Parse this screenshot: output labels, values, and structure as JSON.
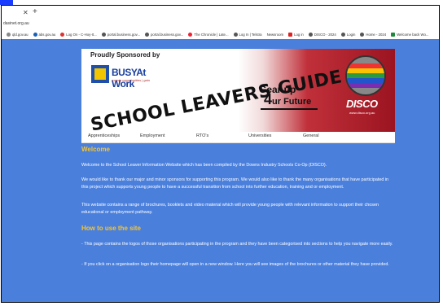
{
  "browser": {
    "url": "dasinet.org.au",
    "bookmarks": [
      "qld.gov.au",
      "abs.gov.au",
      "Log On - C-Hoy-It...",
      "portal.business.gov...",
      "portal.business.gov...",
      "The Chronicle | Late...",
      "Log In | Telstra",
      "Newsroom",
      "Log in",
      "DISCO - 2024",
      "Login",
      "Home - 2024",
      "Welcome back Wo..."
    ]
  },
  "banner": {
    "sponsor_label": "Proudly Sponsored by",
    "busy_name": "BUSYAt Work",
    "busy_tagline": "create opportunities | gain",
    "title": "SCHOOL LEAVERS GUIDE",
    "gear_up": "Gear up",
    "gear_up_4": "4",
    "gear_up_rest": "ur Future",
    "disco": "DISCO",
    "disco_url": "www.disco.org.au",
    "colors": {
      "accent_red": "#b01c28",
      "blue": "#1a3f9e",
      "yellow": "#f2c500"
    }
  },
  "nav": {
    "items": [
      "Apprenticeships",
      "Employment",
      "RTO's",
      "Universities",
      "General"
    ]
  },
  "content": {
    "welcome_heading": "Welcome",
    "welcome_p1": "Welcome to the School Leaver Information Website which has been compiled by the Downs Industry Schools Co-Op (DISCO).",
    "welcome_p2": "We would like to thank our major and minor sponsors for supporting this program. We would also like to thank the many organisations that have participated in this project which supports young people to have a successful transition from school into further education, training and or employment.",
    "welcome_p3": "This website contains a range of brochures, booklets and video material which will provide young people with relevant information to support their chosen educational or employment pathway.",
    "how_heading": "How to use the site",
    "how_p1": "- This page contains the logos of those organisations participating in the program and they have been categorised into sections to help you navigate more easily.",
    "how_p2": "- If you click on a organisation logo their homepage will open in a new window. Here you will see images of the brochures or other material they have provided."
  },
  "page_colors": {
    "background": "#4a7fdc",
    "heading": "#f5c431"
  }
}
